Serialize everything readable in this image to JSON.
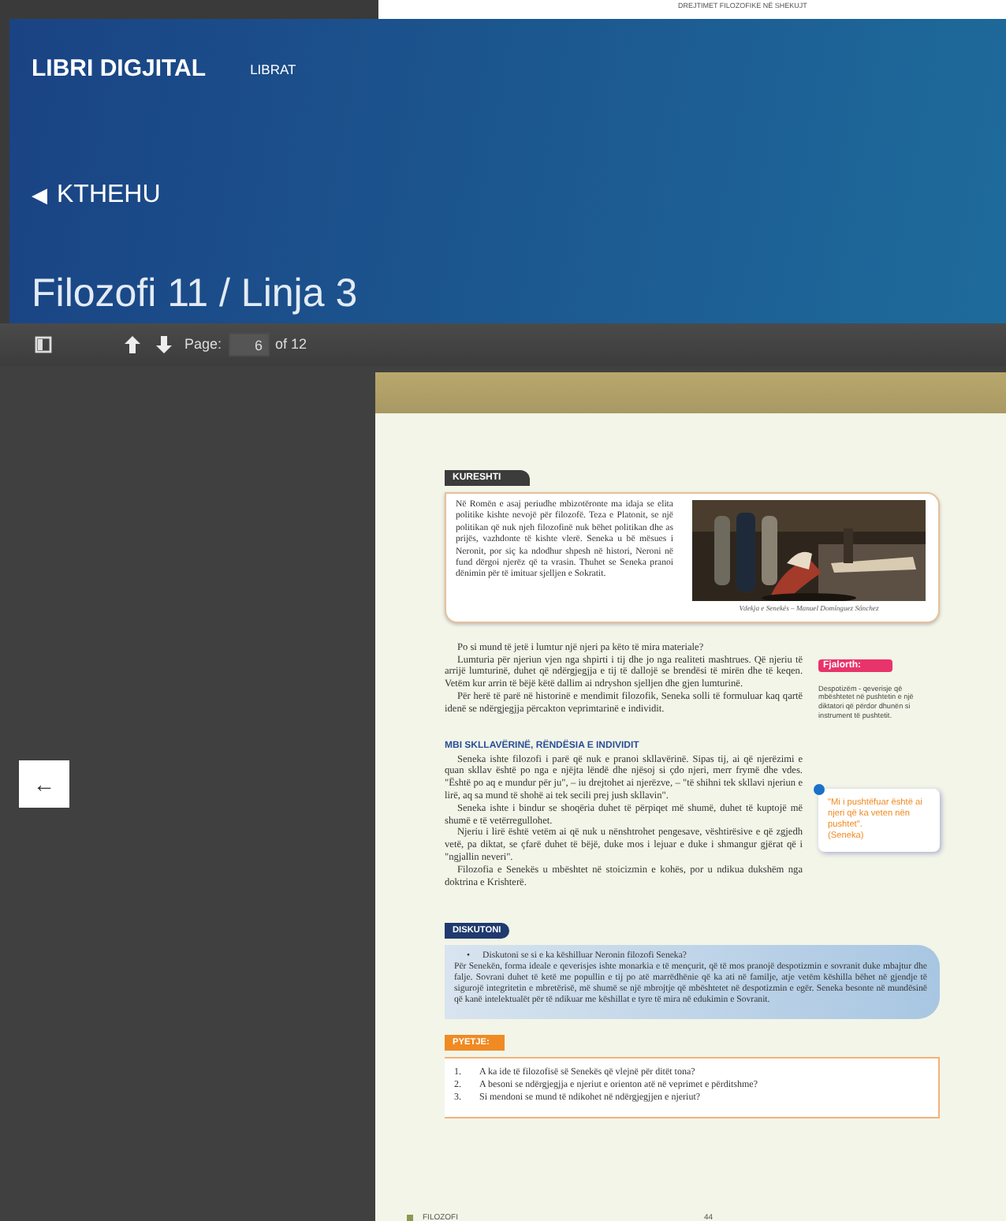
{
  "top_strip": {
    "text": "DREJTIMET FILOZOFIKE NË SHEKUJT"
  },
  "header": {
    "brand": "LIBRI DIGJITAL",
    "nav": "LIBRAT",
    "back_icon": "◀",
    "back": "KTHEHU",
    "title": "Filozofi 11 / Linja 3"
  },
  "toolbar": {
    "page_label": "Page:",
    "page_value": "6",
    "page_total": "of 12"
  },
  "nav_button": {
    "label": "←"
  },
  "document": {
    "kureshti": {
      "label": "KURESHTI",
      "text": "Në Romën e asaj periudhe mbizotëronte ma idaja se elita politike kishte nevojë për filozofë. Teza e Platonit, se një politikan që nuk njeh filozofinë nuk bëhet politikan dhe as prijës, vazhdonte të kishte vlerë. Seneka u bë mësues i Neronit, por siç ka ndodhur shpesh në histori, Neroni në fund dërgoi njerëz që ta vrasin. Thuhet se Seneka pranoi dënimin për të imituar sjelljen e Sokratit.",
      "caption": "Vdekja e Senekës – Manuel Domínguez Sánchez"
    },
    "paragraphs": [
      "Po si mund të jetë i lumtur një njeri pa këto të mira materiale?",
      "Lumturia për njeriun vjen nga shpirti i tij dhe jo nga realiteti mashtrues. Që njeriu të arrijë lumturinë, duhet që ndërgjegjja e tij të dallojë se brendësi të mirën dhe të keqen. Vetëm kur arrin të bëjë këtë dallim ai ndryshon sjelljen dhe gjen lumturinë.",
      "Për herë të parë në historinë e mendimit filozofik, Seneka solli të formuluar kaq qartë idenë se ndërgjegjja përcakton veprimtarinë e individit."
    ],
    "section_heading": "MBI SKLLAVËRINË, RËNDËSIA E INDIVIDIT",
    "paragraphs_2": [
      "Seneka ishte filozofi i parë që nuk e pranoi skllavërinë. Sipas tij, ai që njerëzimi e quan skllav është po nga e njëjta lëndë dhe njësoj si çdo njeri, merr frymë dhe vdes. \"Është po aq e mundur për ju\", – iu drejtohet ai njerëzve, – \"të shihni tek skllavi njeriun e lirë, aq sa mund të shohë ai tek secili prej jush skllavin\".",
      "Seneka ishte i bindur se shoqëria duhet të përpiqet më shumë, duhet të kuptojë më shumë e të vetërregullohet.",
      "Njeriu i lirë është vetëm ai që nuk u nënshtrohet pengesave, vështirësive e që zgjedh vetë, pa diktat, se çfarë duhet të bëjë, duke mos i lejuar e duke i shmangur gjërat që i \"ngjallin neveri\".",
      "Filozofia e Senekës u mbështet në stoicizmin e kohës, por u ndikua dukshëm nga doktrina e Krishterë."
    ],
    "glossary": {
      "label": "Fjalorth:",
      "text": "Despotizëm - qeverisje që mbështetet në pushtetin e një diktatori që përdor dhunën si instrument të pushtetit."
    },
    "quote": {
      "text": "\"Mi i pushtëfuar është ai njeri që ka veten nën pushtet\".",
      "author": "(Seneka)"
    },
    "discuss": {
      "label": "DISKUTONI",
      "bullet": "•",
      "question": "Diskutoni se si e ka këshilluar Neronin filozofi Seneka?",
      "text": "Për Senekën, forma ideale e qeverisjes ishte monarkia e të mençurit, që të mos pranojë despotizmin e sovranit duke mbajtur dhe falje. Sovrani duhet të ketë me popullin e tij po atë marrëdhënie që ka ati në familje, atje vetëm këshilla bëhet në gjendje të sigurojë integritetin e mbretërisë, më shumë se një mbrojtje që mbështetet në despotizmin e egër. Seneka besonte në mundësinë që kanë intelektualët për të ndikuar me këshillat e tyre të mira në edukimin e Sovranit."
    },
    "questions": {
      "label": "PYETJE:",
      "items": [
        {
          "number": "1.",
          "text": "A ka ide të filozofisë së Senekës që vlejnë për ditët tona?"
        },
        {
          "number": "2.",
          "text": "A besoni se ndërgjegjja e njeriut e orienton atë në veprimet e përditshme?"
        },
        {
          "number": "3.",
          "text": "Si mendoni se mund të ndikohet në ndërgjegjjen e njeriut?"
        }
      ]
    },
    "footer": {
      "subject": "FILOZOFI",
      "page": "44"
    }
  }
}
